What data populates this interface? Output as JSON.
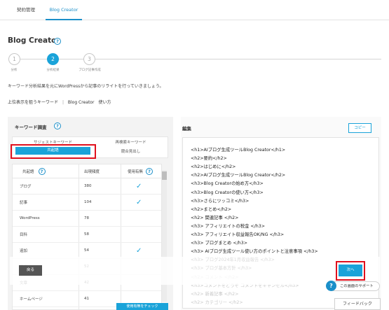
{
  "nav": {
    "tabs": [
      {
        "label": "契約管理"
      },
      {
        "label": "Blog Creator"
      }
    ]
  },
  "page": {
    "title": "Blog Creator",
    "help_icon": "?"
  },
  "steps": [
    {
      "number": "1",
      "label": "分析"
    },
    {
      "number": "2",
      "label": "分析結果"
    },
    {
      "number": "3",
      "label": "ブログ記事作成"
    }
  ],
  "description": "キーワード分析結果を元にWordPressから記事のリライトを行っていきましょう。",
  "keyword": {
    "label": "上位表示を狙うキーワード",
    "separator": "|",
    "value": "Blog Creator　使い方"
  },
  "keyword_survey": {
    "title": "キーワード調査",
    "tabs": [
      "サジェストキーワード",
      "再検索キーワード",
      "共起語",
      "競合見出し"
    ],
    "active_tab": "共起語",
    "table": {
      "headers": [
        "共起語",
        "出現頻度",
        "使用有無"
      ],
      "rows": [
        {
          "word": "ブログ",
          "freq": "380",
          "used": true
        },
        {
          "word": "記事",
          "freq": "104",
          "used": true
        },
        {
          "word": "WordPress",
          "freq": "78",
          "used": false
        },
        {
          "word": "目科",
          "freq": "58",
          "used": false
        },
        {
          "word": "追加",
          "freq": "54",
          "used": true
        },
        {
          "word": "活用",
          "freq": "52",
          "used": false
        },
        {
          "word": "文章",
          "freq": "42",
          "used": false
        },
        {
          "word": "ホームページ",
          "freq": "41",
          "used": false
        }
      ]
    },
    "check_button": "使用有無をチェック"
  },
  "editor": {
    "title": "編集",
    "copy_button": "コピー",
    "lines": [
      {
        "text": "<h1>AIブログ生成ツールBlog Creator</h1>",
        "faded": false
      },
      {
        "text": "<h2>要約</h2>",
        "faded": false
      },
      {
        "text": "<h2>はじめに</h2>",
        "faded": false
      },
      {
        "text": "<h2>AIブログ生成ツールBlog Creator</h2>",
        "faded": false
      },
      {
        "text": "<h3>Blog Creatorの始め方</h3>",
        "faded": false
      },
      {
        "text": "<h3>Blog Creatorの使い方</h3>",
        "faded": false
      },
      {
        "text": "<h3>さらにツッコミ</h3>",
        "faded": false
      },
      {
        "text": "<h2>まとめ</h2>",
        "faded": false
      },
      {
        "text": "<h2> 関連記事 </h2>",
        "faded": false
      },
      {
        "text": "<h3> アフィリエイトの税金 </h3>",
        "faded": false
      },
      {
        "text": "<h3> アフィリエイト収益報告OK/NG </h3>",
        "faded": false
      },
      {
        "text": "<h3> ブログまとめ </h3>",
        "faded": false
      },
      {
        "text": "<h3> AIブログ生成ツール使い方のポイントと注意事項 </h3>",
        "faded": false
      },
      {
        "text": "<h3> ブログ2024年1月収益報告 </h3>",
        "faded": false
      },
      {
        "text": "<h3> ブログ基本方針 </h3>",
        "faded": false
      },
      {
        "text": "<h2> コメント </h2>",
        "faded": true
      },
      {
        "text": "<h3>コメントをどうぞ コメントをキャンセル</h3>",
        "faded": true
      },
      {
        "text": "<h2> 新着記事 </h2>",
        "faded": true
      },
      {
        "text": "<h2> カテゴリー </h2>",
        "faded": true
      }
    ]
  },
  "footer": {
    "back_button": "戻る",
    "next_button": "次へ",
    "support_label": "この画面のサポート",
    "feedback_button": "フィードバック"
  },
  "colors": {
    "accent": "#1aa3d9",
    "highlight": "#e0101d"
  },
  "icons": {
    "help": "question-circle-icon",
    "check": "checkmark-icon",
    "support": "question-circle-icon"
  }
}
